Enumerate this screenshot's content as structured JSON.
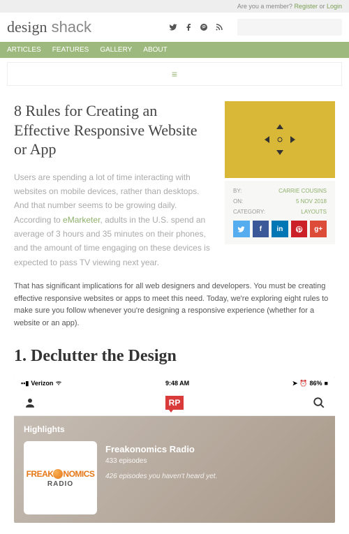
{
  "topBar": {
    "prompt": "Are you a member? ",
    "register": "Register",
    "or": " or ",
    "login": "Login"
  },
  "logo": {
    "a": "design",
    "b": " shack"
  },
  "nav": [
    "ARTICLES",
    "FEATURES",
    "GALLERY",
    "ABOUT"
  ],
  "article": {
    "title": "8 Rules for Creating an Effective Responsive Website or App",
    "intro_a": "Users are spending a lot of time interacting with websites on mobile devices, rather than desktops. And that number seems to be growing daily. According to ",
    "intro_link": "eMarketer",
    "intro_b": ", adults in the U.S. spend an average of 3 hours and 35 minutes on their phones, and the amount of time engaging on these devices is expected to pass TV viewing next year.",
    "para2": "That has significant implications for all web designers and developers. You must be creating effective responsive websites or apps to meet this need. Today, we're exploring eight rules to make sure you follow whenever you're designing a responsive experience (whether for a website or an app).",
    "h2": "1. Declutter the Design"
  },
  "meta": {
    "by_label": "BY:",
    "by": "CARRIE COUSINS",
    "on_label": "ON:",
    "on": "5 NOV 2018",
    "cat_label": "CATEGORY:",
    "cat": "LAYOUTS"
  },
  "phone": {
    "carrier": "Verizon",
    "time": "9:48 AM",
    "battery": "86%",
    "highlights": "Highlights",
    "podcast": {
      "name": "Freakonomics Radio",
      "eps": "433 episodes",
      "unheard": "426 episodes you haven't heard yet.",
      "art_a": "FREAK",
      "art_b": "NOMICS",
      "art_c": "RADIO"
    }
  }
}
